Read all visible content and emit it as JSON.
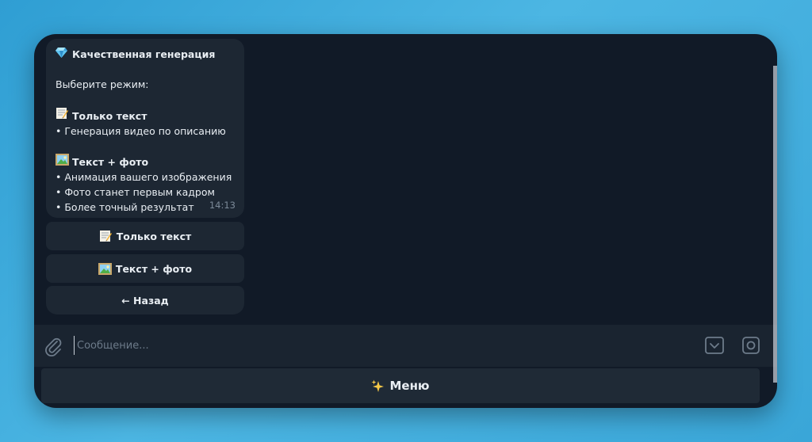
{
  "message": {
    "title": "Качественная генерация",
    "prompt": "Выберите режим:",
    "option_text_title": "Только текст",
    "option_text_desc": "• Генерация видео по описанию",
    "option_photo_title": "Текст + фото",
    "option_photo_lines": [
      "• Анимация вашего изображения",
      "• Фото станет первым кадром",
      "• Более точный результат"
    ],
    "time": "14:13"
  },
  "keyboard": {
    "text_only": "Только текст",
    "text_photo": "Текст + фото",
    "back": "← Назад"
  },
  "input": {
    "placeholder": "Сообщение..."
  },
  "menu": {
    "label": "Меню"
  },
  "icons": {
    "title": "gem-icon",
    "text_only": "memo-icon",
    "text_photo": "picture-icon",
    "menu": "sparkles-icon"
  },
  "colors": {
    "background": "#111a27",
    "bubble": "#1d2733",
    "text": "#e9eef3",
    "muted": "#7c8a99"
  }
}
